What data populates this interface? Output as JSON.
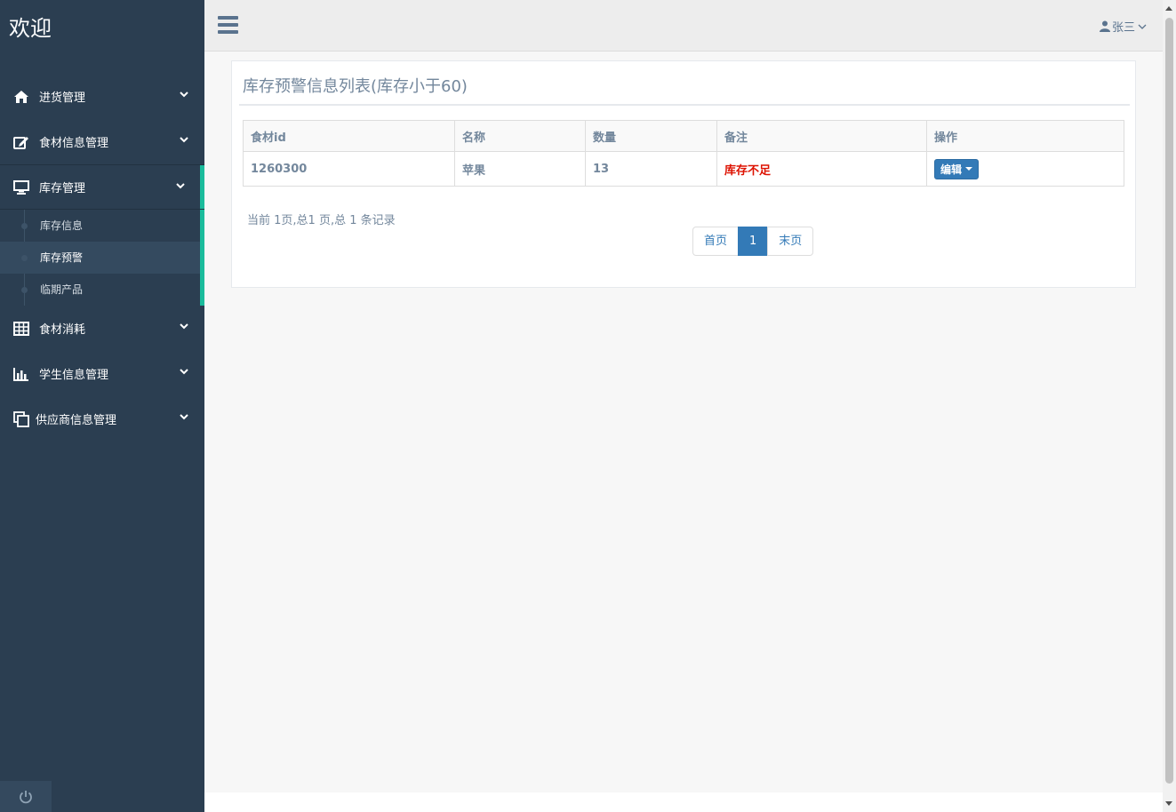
{
  "sidebar": {
    "brand": "欢迎",
    "items": [
      {
        "label": "进货管理",
        "icon": "home-icon"
      },
      {
        "label": "食材信息管理",
        "icon": "edit-icon"
      },
      {
        "label": "库存管理",
        "icon": "monitor-icon",
        "active": true
      },
      {
        "label": "食材消耗",
        "icon": "table-icon"
      },
      {
        "label": "学生信息管理",
        "icon": "bar-chart-icon"
      },
      {
        "label": "供应商信息管理",
        "icon": "copy-icon"
      }
    ],
    "submenu": [
      {
        "label": "库存信息"
      },
      {
        "label": "库存预警",
        "current": true
      },
      {
        "label": "临期产品"
      }
    ],
    "power_icon": "power-icon"
  },
  "topbar": {
    "menu_icon": "hamburger-icon",
    "user_name": "张三",
    "user_icon": "user-icon"
  },
  "panel": {
    "title": "库存预警信息列表(库存小于60)"
  },
  "table": {
    "headers": [
      "食材id",
      "名称",
      "数量",
      "备注",
      "操作"
    ],
    "rows": [
      {
        "id": "1260300",
        "name": "苹果",
        "qty": "13",
        "note": "库存不足",
        "action": "编辑"
      }
    ]
  },
  "pagination": {
    "info": "当前 1页,总1 页,总 1 条记录",
    "first": "首页",
    "current": "1",
    "last": "末页"
  },
  "colors": {
    "sidebar_bg": "#2b3e51",
    "accent": "#1abc9c",
    "primary": "#337ab7",
    "warning_text": "#dd1100",
    "body_text": "#73879c"
  }
}
